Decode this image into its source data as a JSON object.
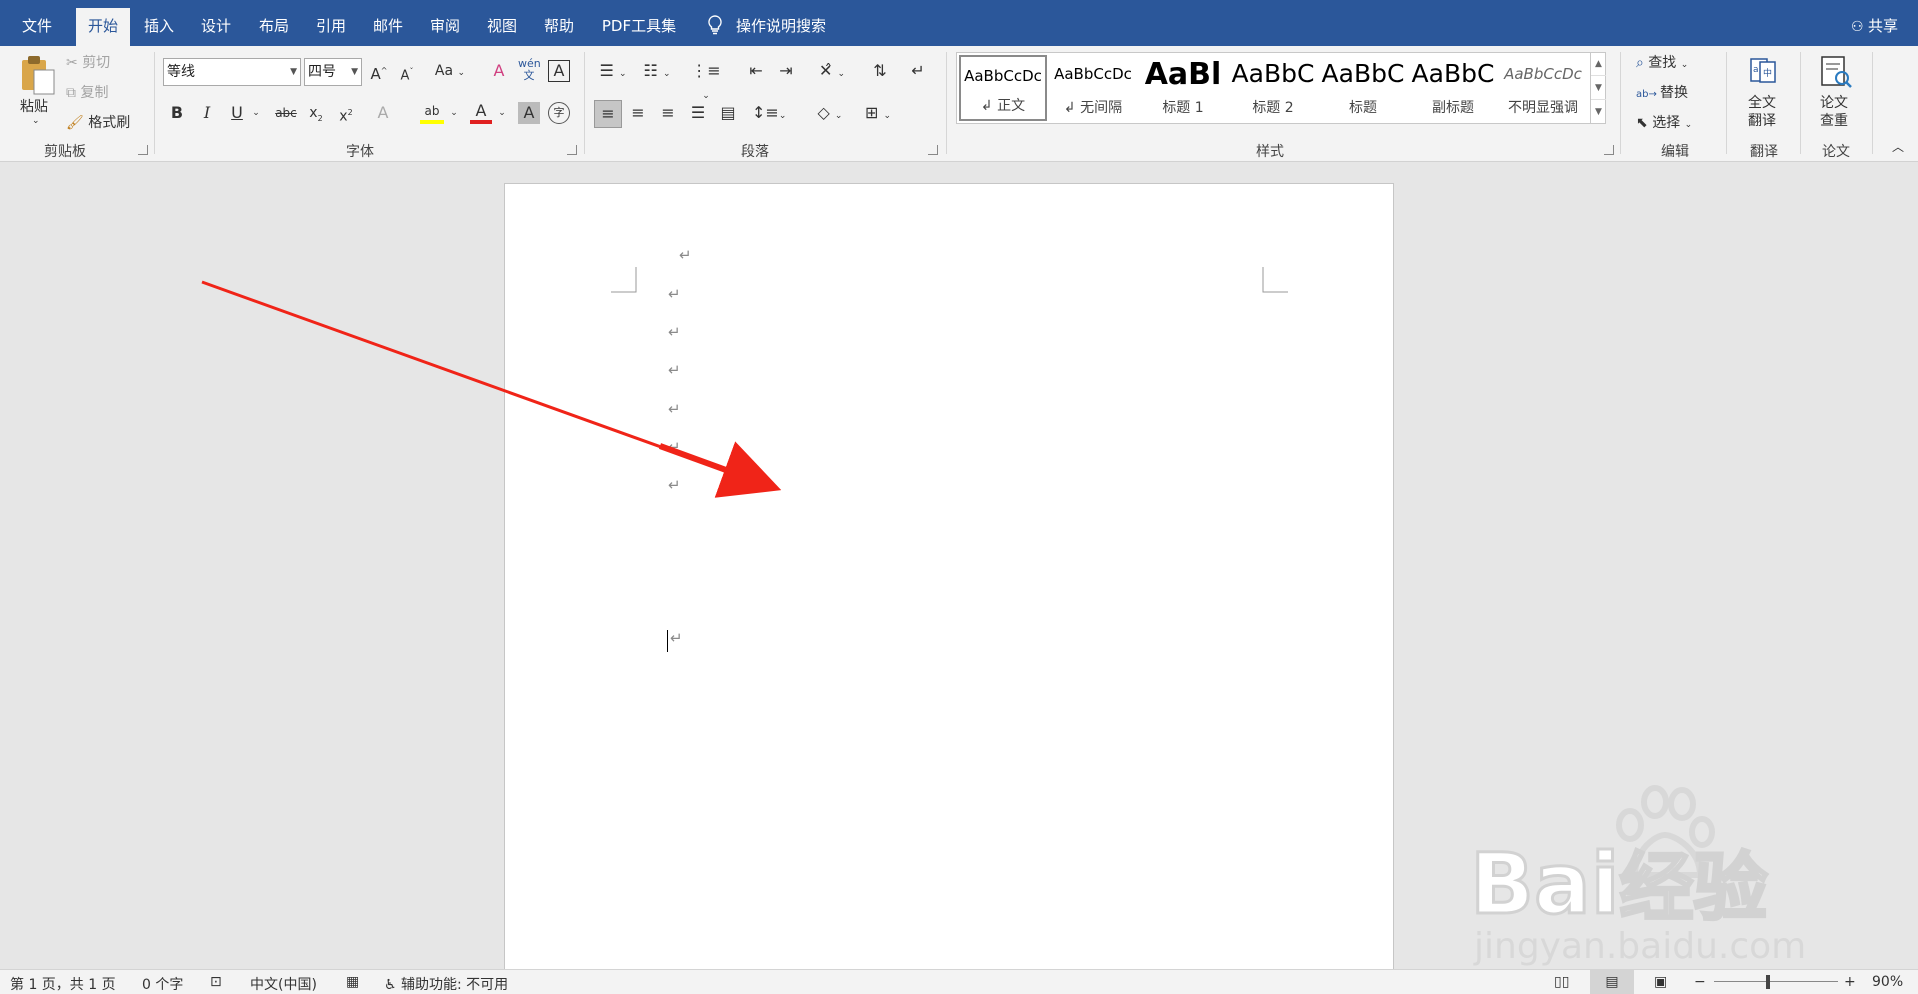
{
  "tabs": [
    "文件",
    "开始",
    "插入",
    "设计",
    "布局",
    "引用",
    "邮件",
    "审阅",
    "视图",
    "帮助",
    "PDF工具集"
  ],
  "active_tab": "开始",
  "search_label": "操作说明搜索",
  "share_label": "共享",
  "clipboard": {
    "paste": "粘贴",
    "cut": "剪切",
    "copy": "复制",
    "format_painter": "格式刷",
    "group": "剪贴板"
  },
  "font": {
    "name": "等线",
    "size": "四号",
    "group": "字体",
    "bold": "B",
    "italic": "I",
    "underline": "U",
    "strike": "abc",
    "grow": "A",
    "shrink": "A",
    "case": "Aa",
    "color_letter": "A",
    "highlight_letter": "ab"
  },
  "paragraph": {
    "group": "段落"
  },
  "styles": {
    "group": "样式",
    "items": [
      {
        "preview": "AaBbCcDc",
        "name": "↲ 正文"
      },
      {
        "preview": "AaBbCcDc",
        "name": "↲ 无间隔"
      },
      {
        "preview": "AaBl",
        "name": "标题 1"
      },
      {
        "preview": "AaBbC",
        "name": "标题 2"
      },
      {
        "preview": "AaBbC",
        "name": "标题"
      },
      {
        "preview": "AaBbC",
        "name": "副标题"
      },
      {
        "preview": "AaBbCcDc",
        "name": "不明显强调"
      }
    ]
  },
  "editing": {
    "find": "查找",
    "replace": "替换",
    "select": "选择",
    "group": "编辑"
  },
  "translate": {
    "button_line1": "全文",
    "button_line2": "翻译",
    "group": "翻译"
  },
  "paper": {
    "button_line1": "论文",
    "button_line2": "查重",
    "group": "论文"
  },
  "document": {
    "paragraph_mark": "↵",
    "paragraph_mark_count": 8
  },
  "status": {
    "page": "第 1 页，共 1 页",
    "words": "0 个字",
    "language": "中文(中国)",
    "accessibility": "辅助功能: 不可用",
    "zoom": "90%"
  },
  "watermark": {
    "brand": "Bai",
    "brand_suffix": "经验",
    "url": "jingyan.baidu.com"
  },
  "colors": {
    "title_bar": "#2b579a",
    "annotation_arrow": "#f02418",
    "font_color_bar": "#e02020",
    "highlight_bar": "#ffff00"
  }
}
